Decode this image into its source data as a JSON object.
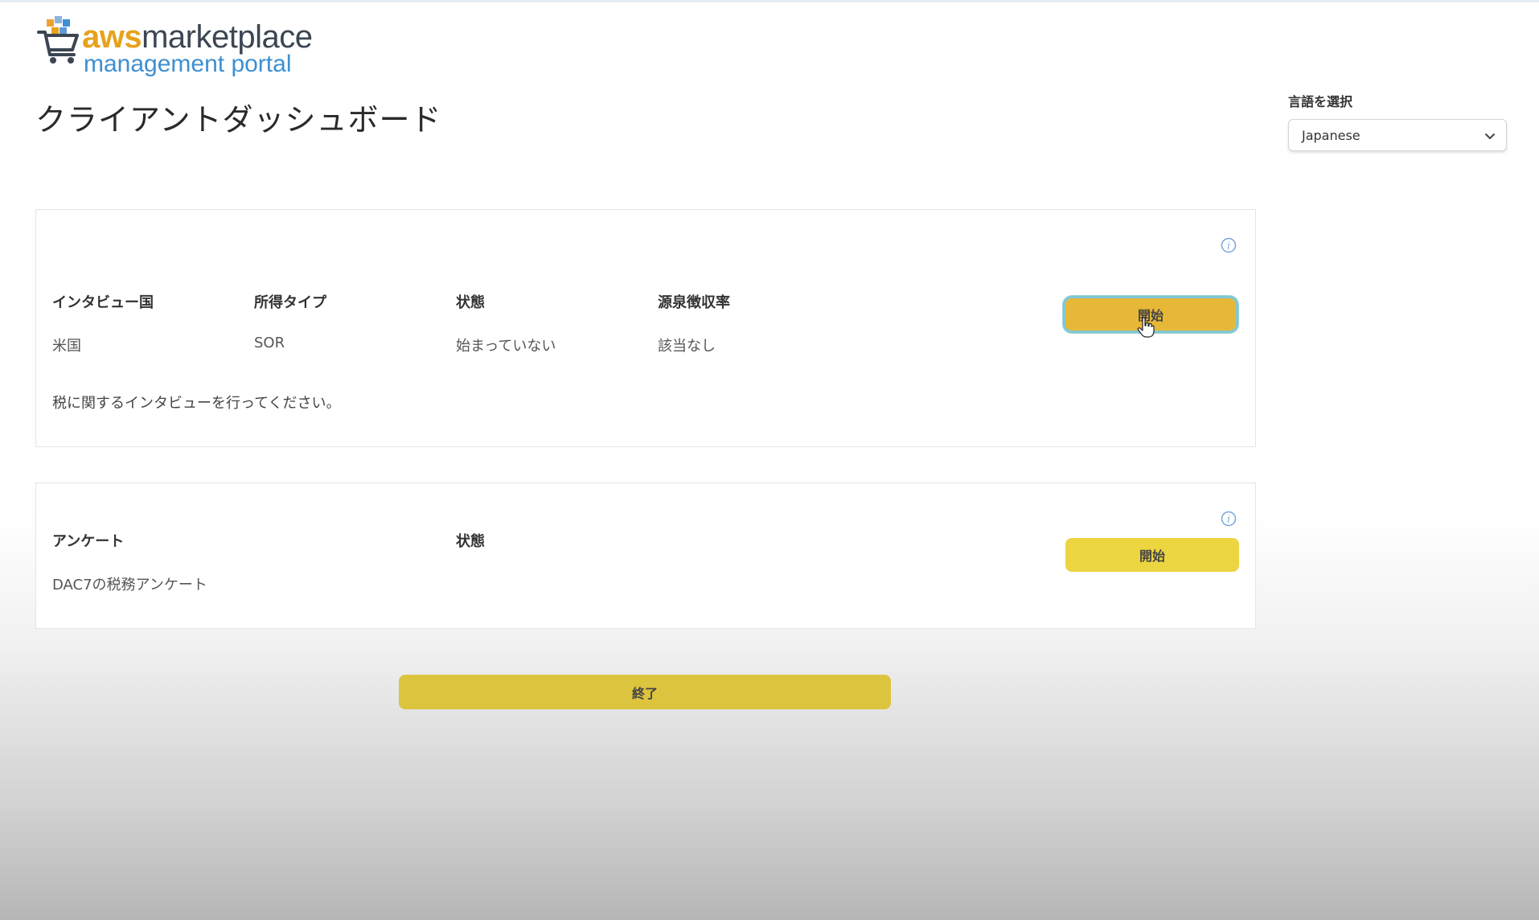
{
  "logo": {
    "brand_aws": "aws",
    "brand_marketplace": "marketplace",
    "brand_subtitle": "management portal",
    "colors": {
      "aws": "#e6a21c",
      "marketplace": "#3c4652",
      "subtitle": "#3d8fd1"
    }
  },
  "page": {
    "title": "クライアントダッシュボード"
  },
  "language": {
    "label": "言語を選択",
    "selected": "Japanese"
  },
  "interview_card": {
    "headers": {
      "country": "インタビュー国",
      "income_type": "所得タイプ",
      "status": "状態",
      "withholding_rate": "源泉徴収率"
    },
    "values": {
      "country": "米国",
      "income_type": "SOR",
      "status": "始まっていない",
      "withholding_rate": "該当なし"
    },
    "note": "税に関するインタビューを行ってください。",
    "start_label": "開始",
    "info_icon": "info-icon"
  },
  "survey_card": {
    "headers": {
      "survey": "アンケート",
      "status": "状態"
    },
    "values": {
      "survey": "DAC7の税務アンケート"
    },
    "start_label": "開始",
    "info_icon": "info-icon"
  },
  "actions": {
    "finish_label": "終了"
  },
  "colors": {
    "button_active": "#e7b837",
    "button": "#ecd540",
    "button_finish": "#dcc43e",
    "focus_ring": "#7fc8d4"
  }
}
